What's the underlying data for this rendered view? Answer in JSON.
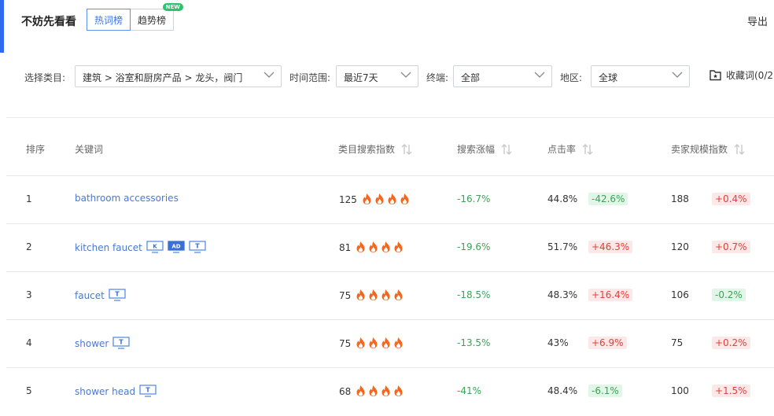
{
  "header": {
    "title": "不妨先看看",
    "tabs": [
      {
        "label": "热词榜",
        "active": true
      },
      {
        "label": "趋势榜",
        "badge": "NEW"
      }
    ],
    "export_label": "导出"
  },
  "filters": {
    "category_label": "选择类目:",
    "category_value": "建筑 > 浴室和厨房产品 > 龙头，阀门",
    "time_label": "时间范围:",
    "time_value": "最近7天",
    "terminal_label": "终端:",
    "terminal_value": "全部",
    "region_label": "地区:",
    "region_value": "全球",
    "favorites_label": "收藏词(0/2"
  },
  "table": {
    "headers": {
      "rank": "排序",
      "keyword": "关键词",
      "search_index": "类目搜索指数",
      "search_growth": "搜索涨幅",
      "ctr": "点击率",
      "seller_index": "卖家规模指数"
    },
    "rows": [
      {
        "rank": "1",
        "keyword": "bathroom accessories",
        "icons": [],
        "search_index": "125",
        "flames": 4,
        "search_growth": "-16.7%",
        "ctr": "44.8%",
        "ctr_change": "-42.6%",
        "ctr_change_dir": "down",
        "seller_index": "188",
        "seller_change": "+0.4%",
        "seller_change_dir": "up"
      },
      {
        "rank": "2",
        "keyword": "kitchen faucet",
        "icons": [
          "K",
          "AD",
          "T"
        ],
        "search_index": "81",
        "flames": 4,
        "search_growth": "-19.6%",
        "ctr": "51.7%",
        "ctr_change": "+46.3%",
        "ctr_change_dir": "up",
        "seller_index": "120",
        "seller_change": "+0.7%",
        "seller_change_dir": "up"
      },
      {
        "rank": "3",
        "keyword": "faucet",
        "icons": [
          "T"
        ],
        "search_index": "75",
        "flames": 4,
        "search_growth": "-18.5%",
        "ctr": "48.3%",
        "ctr_change": "+16.4%",
        "ctr_change_dir": "up",
        "seller_index": "106",
        "seller_change": "-0.2%",
        "seller_change_dir": "down"
      },
      {
        "rank": "4",
        "keyword": "shower",
        "icons": [
          "T"
        ],
        "search_index": "75",
        "flames": 4,
        "search_growth": "-13.5%",
        "ctr": "43%",
        "ctr_change": "+6.9%",
        "ctr_change_dir": "up",
        "seller_index": "75",
        "seller_change": "+0.2%",
        "seller_change_dir": "up"
      },
      {
        "rank": "5",
        "keyword": "shower head",
        "icons": [
          "T"
        ],
        "search_index": "68",
        "flames": 4,
        "search_growth": "-41%",
        "ctr": "48.4%",
        "ctr_change": "-6.1%",
        "ctr_change_dir": "down",
        "seller_index": "100",
        "seller_change": "+1.5%",
        "seller_change_dir": "up"
      }
    ]
  },
  "colors": {
    "accent": "#2d6bf0",
    "keyword": "#4a78d6",
    "positive": "#e0403a",
    "negative": "#3aa356",
    "flame": "#f5661e"
  }
}
